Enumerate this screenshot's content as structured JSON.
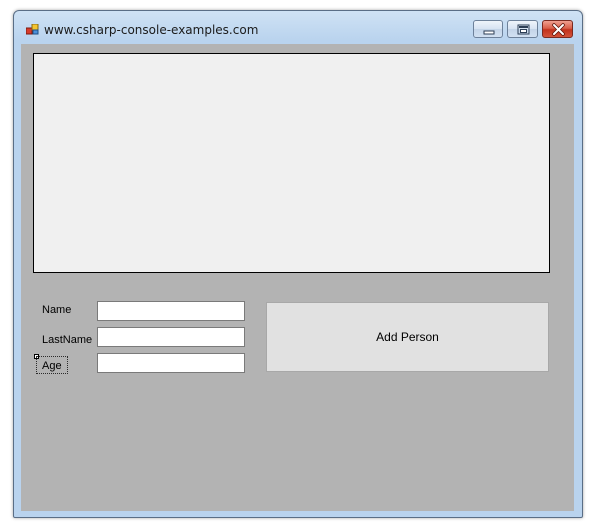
{
  "window": {
    "title": "www.csharp-console-examples.com"
  },
  "form": {
    "name_label": "Name",
    "lastname_label": "LastName",
    "age_label": "Age",
    "name_value": "",
    "lastname_value": "",
    "age_value": "",
    "add_button_label": "Add Person",
    "list_items": []
  },
  "icons": {
    "app": "winforms-app-icon",
    "minimize": "minimize-icon",
    "maximize": "maximize-icon",
    "close": "close-icon"
  },
  "colors": {
    "form_background": "#b3b3b3",
    "listbox_background": "#f0f0f0",
    "button_background": "#e1e1e1",
    "close_button": "#c2321c"
  }
}
